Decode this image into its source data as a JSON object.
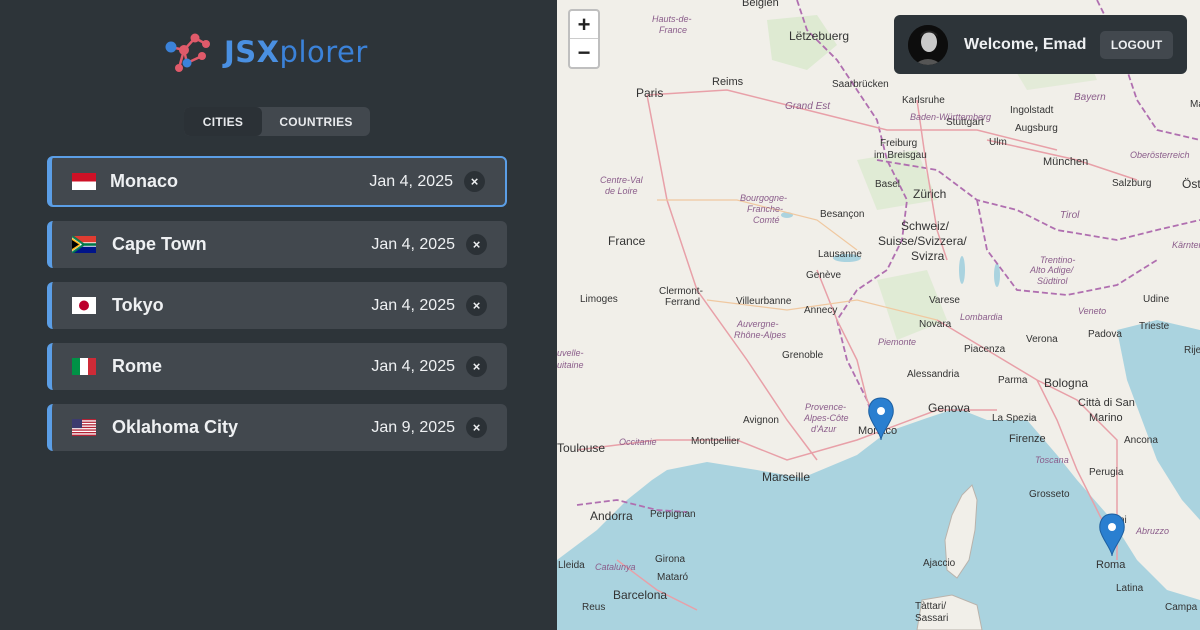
{
  "app": {
    "logo_part1": "JSX",
    "logo_part2": "plorer"
  },
  "tabs": [
    {
      "label": "CITIES",
      "active": true
    },
    {
      "label": "COUNTRIES",
      "active": false
    }
  ],
  "cities": [
    {
      "name": "Monaco",
      "date": "Jan 4, 2025",
      "flag": "monaco-flag-icon",
      "selected": true
    },
    {
      "name": "Cape Town",
      "date": "Jan 4, 2025",
      "flag": "south-africa-flag-icon",
      "selected": false
    },
    {
      "name": "Tokyo",
      "date": "Jan 4, 2025",
      "flag": "japan-flag-icon",
      "selected": false
    },
    {
      "name": "Rome",
      "date": "Jan 4, 2025",
      "flag": "italy-flag-icon",
      "selected": false
    },
    {
      "name": "Oklahoma City",
      "date": "Jan 9, 2025",
      "flag": "usa-flag-icon",
      "selected": false
    }
  ],
  "delete_symbol": "×",
  "user": {
    "welcome": "Welcome, Emad",
    "logout": "LOGOUT"
  },
  "map": {
    "zoom_in": "+",
    "zoom_out": "−",
    "labels": {
      "belgien": "Belgien",
      "letzebuerg": "Lëtzebuerg",
      "hauts_de_france": "Hauts-de-",
      "hauts_de_france2": "France",
      "reims": "Reims",
      "paris": "Paris",
      "saarbrucken": "Saarbrücken",
      "karlsruhe": "Karlsruhe",
      "ingolstadt": "Ingolstadt",
      "bayern": "Bayern",
      "grand_est": "Grand Est",
      "stuttgart": "Stuttgart",
      "baden": "Baden-Württemberg",
      "augsburg": "Augsburg",
      "centre": "Centre-Val",
      "centre2": "de Loire",
      "freiburg": "Freiburg",
      "freiburg2": "im Breisgau",
      "ulm": "Ulm",
      "munchen": "München",
      "oberosterreich": "Oberösterreich",
      "basel": "Basel",
      "zurich": "Zürich",
      "salzburg": "Salzburg",
      "ost": "Öst",
      "bourgogne": "Bourgogne-",
      "bourgogne2": "Franche-",
      "bourgogne3": "Comté",
      "besancon": "Besançon",
      "schweiz": "Schweiz/",
      "suisse": "Suisse/Svizzera/",
      "svizra": "Svizra",
      "tirol": "Tirol",
      "karnten": "Kärnten",
      "france": "France",
      "lausanne": "Lausanne",
      "trentino": "Trentino-",
      "alto_adige": "Alto Adige/",
      "sudtirol": "Südtirol",
      "geneve": "Genève",
      "limoges": "Limoges",
      "clermont": "Clermont-",
      "ferrand": "Ferrand",
      "villeurbanne": "Villeurbanne",
      "annecy": "Annecy",
      "varese": "Varese",
      "udine": "Udine",
      "auvergne": "Auvergne-",
      "rhone": "Rhône-Alpes",
      "lombardia": "Lombardia",
      "veneto": "Veneto",
      "trieste": "Trieste",
      "novara": "Novara",
      "verona": "Verona",
      "nouvelle": "uvelle-",
      "aquitaine": "uitaine",
      "grenoble": "Grenoble",
      "piemonte": "Piemonte",
      "padova": "Padova",
      "piacenza": "Piacenza",
      "alessandria": "Alessandria",
      "parma": "Parma",
      "bologna": "Bologna",
      "provence": "Provence-",
      "alpes": "Alpes-Côte",
      "dazur": "d'Azur",
      "avignon": "Avignon",
      "genova": "Genova",
      "la_spezia": "La Spezia",
      "citta": "Città di San",
      "marino": "Marino",
      "monaco": "Monaco",
      "toulouse": "Toulouse",
      "occitanie": "Occitanie",
      "montpellier": "Montpellier",
      "firenze": "Firenze",
      "ancona": "Ancona",
      "toscana": "Toscana",
      "perugia": "Perugia",
      "marseille": "Marseille",
      "grosseto": "Grosseto",
      "andorra": "Andorra",
      "perpignan": "Perpignan",
      "abruzzo": "Abruzzo",
      "girona": "Girona",
      "lleida": "Lleida",
      "catalunya": "Catalunya",
      "ajaccio": "Ajaccio",
      "roma": "Roma",
      "mataro": "Mataró",
      "barcelona": "Barcelona",
      "latina": "Latina",
      "reus": "Reus",
      "tattari": "Tàttari/",
      "sassari": "Sassari",
      "campa": "Campa",
      "ni": "ni",
      "ma": "Ma",
      "rije": "Rije"
    }
  },
  "colors": {
    "sidebar": "#2d3439",
    "accent": "#5b9ee6",
    "item": "#42484e",
    "marker": "#2a7fd0",
    "sea": "#aad3df",
    "land": "#f1efe9"
  }
}
